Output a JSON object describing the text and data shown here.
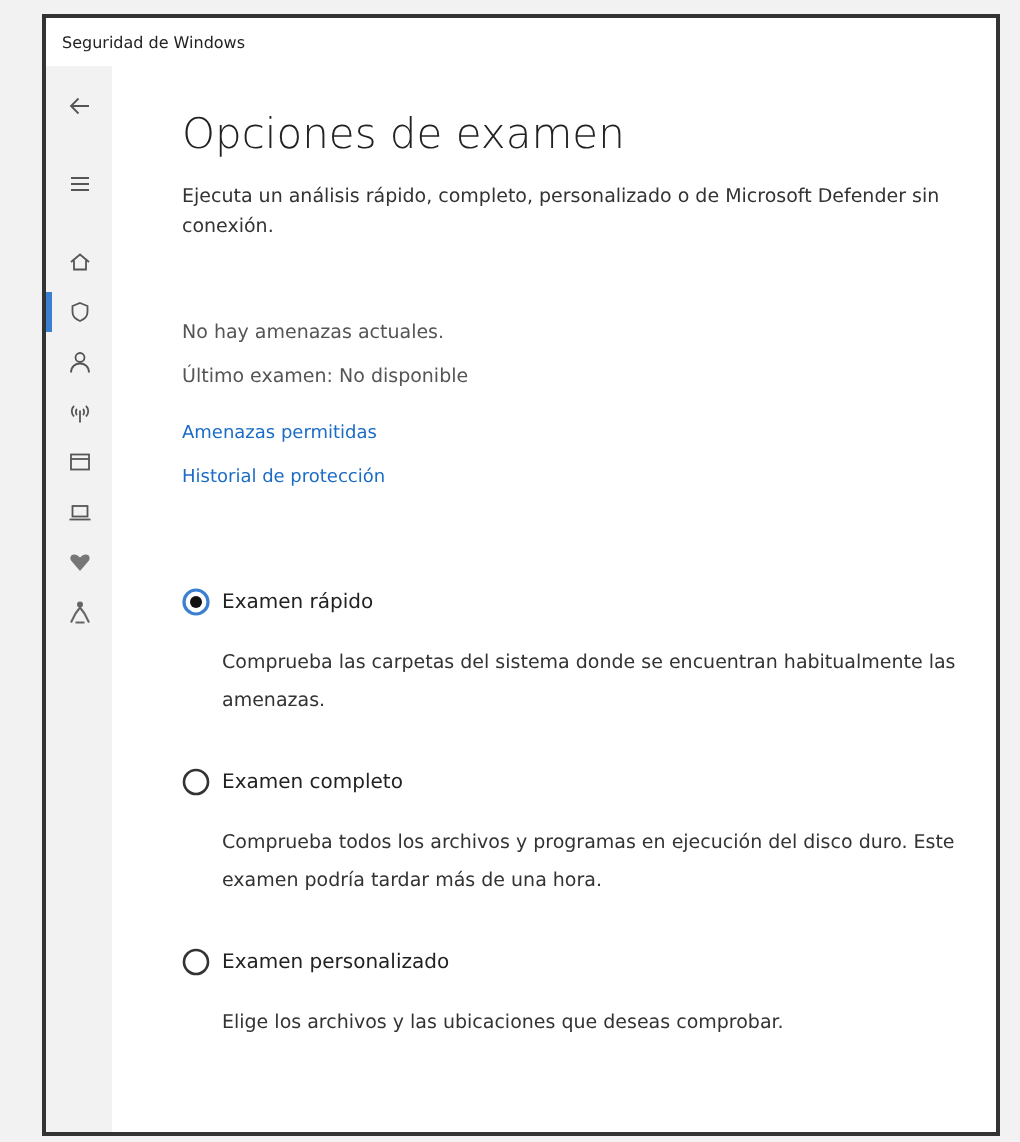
{
  "window": {
    "title": "Seguridad de Windows"
  },
  "sidebar": {
    "items": [
      {
        "kind": "back",
        "selected": false
      },
      {
        "kind": "menu",
        "selected": false
      },
      {
        "kind": "home",
        "selected": false
      },
      {
        "kind": "shield",
        "selected": true
      },
      {
        "kind": "person",
        "selected": false
      },
      {
        "kind": "network",
        "selected": false
      },
      {
        "kind": "window",
        "selected": false
      },
      {
        "kind": "laptop",
        "selected": false
      },
      {
        "kind": "heart",
        "selected": false
      },
      {
        "kind": "family",
        "selected": false
      }
    ]
  },
  "page": {
    "title": "Opciones de examen",
    "description": "Ejecuta un análisis rápido, completo, personalizado o de Microsoft Defender sin conexión.",
    "status": [
      "No hay amenazas actuales.",
      "Último examen: No disponible"
    ],
    "links": [
      "Amenazas permitidas",
      "Historial de protección"
    ],
    "options": [
      {
        "label": "Examen rápido",
        "description": "Comprueba las carpetas del sistema donde se encuentran habitualmente las amenazas.",
        "selected": true
      },
      {
        "label": "Examen completo",
        "description": "Comprueba todos los archivos y programas en ejecución del disco duro. Este examen podría tardar más de una hora.",
        "selected": false
      },
      {
        "label": "Examen personalizado",
        "description": "Elige los archivos y las ubicaciones que deseas comprobar.",
        "selected": false
      }
    ]
  }
}
